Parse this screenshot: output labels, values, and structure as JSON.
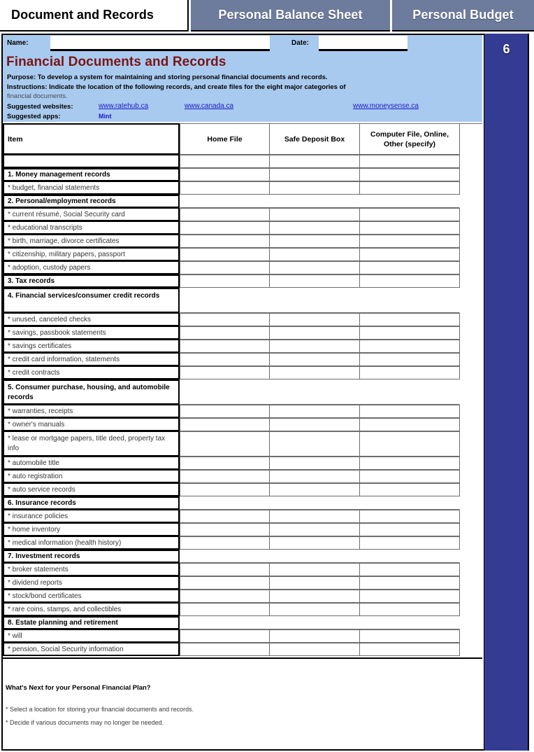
{
  "tabs": [
    {
      "label": "Document and Records",
      "active": true
    },
    {
      "label": "Personal Balance Sheet",
      "active": false
    },
    {
      "label": "Personal Budget",
      "active": false
    }
  ],
  "sidebar": {
    "page_number": "6"
  },
  "header": {
    "name_label": "Name:",
    "name_value": "",
    "name_placeholder": "",
    "date_label": "Date:",
    "date_value": "",
    "date_placeholder": "",
    "title": "Financial Documents and Records",
    "purpose": "Purpose: To develop a system for maintaining and storing personal financial documents and records.",
    "instructions_line1": "Instructions: Indicate the location of the following records, and create files for the eight major categories of",
    "instructions_line2": "financial documents.",
    "websites_label": "Suggested websites:",
    "apps_label": "Suggested apps:",
    "websites": [
      "www.ratehub.ca",
      "www.canada.ca",
      "www.moneysense.ca"
    ],
    "apps": [
      "Mint"
    ]
  },
  "table": {
    "columns": [
      "Item",
      "Home File",
      "Safe Deposit Box",
      "Computer File, Online, Other (specify)"
    ],
    "rows": [
      {
        "label": "",
        "type": "blank",
        "cells": [
          "",
          "",
          ""
        ]
      },
      {
        "label": "1. Money management records",
        "type": "section",
        "cells": [
          "",
          "",
          ""
        ]
      },
      {
        "label": "* budget, financial statements",
        "type": "item",
        "cells": [
          "",
          "",
          ""
        ]
      },
      {
        "label": "2. Personal/employment records",
        "type": "section",
        "cells": []
      },
      {
        "label": "* current résumé, Social Security card",
        "type": "item",
        "cells": [
          "",
          "",
          ""
        ]
      },
      {
        "label": "* educational transcripts",
        "type": "item",
        "cells": [
          "",
          "",
          ""
        ]
      },
      {
        "label": "* birth, marriage, divorce certificates",
        "type": "item",
        "cells": [
          "",
          "",
          ""
        ]
      },
      {
        "label": "* citizenship, military papers, passport",
        "type": "item",
        "cells": [
          "",
          "",
          ""
        ]
      },
      {
        "label": "* adoption, custody papers",
        "type": "item",
        "cells": [
          "",
          "",
          ""
        ]
      },
      {
        "label": "3. Tax records",
        "type": "section",
        "cells": [
          "",
          "",
          ""
        ]
      },
      {
        "label": "4. Financial services/consumer credit records",
        "type": "section2",
        "cells": []
      },
      {
        "label": "* unused, canceled checks",
        "type": "item",
        "cells": [
          "",
          "",
          ""
        ]
      },
      {
        "label": "* savings, passbook statements",
        "type": "item",
        "cells": [
          "",
          "",
          ""
        ]
      },
      {
        "label": "* savings certificates",
        "type": "item",
        "cells": [
          "",
          "",
          ""
        ]
      },
      {
        "label": "* credit card information, statements",
        "type": "item",
        "cells": [
          "",
          "",
          ""
        ]
      },
      {
        "label": "* credit contracts",
        "type": "item",
        "cells": [
          "",
          "",
          ""
        ]
      },
      {
        "label": "5. Consumer purchase, housing, and automobile records",
        "type": "section2",
        "cells": []
      },
      {
        "label": "* warranties, receipts",
        "type": "item",
        "cells": [
          "",
          "",
          ""
        ]
      },
      {
        "label": "* owner's manuals",
        "type": "item",
        "cells": [
          "",
          "",
          ""
        ]
      },
      {
        "label": "* lease or mortgage papers, title deed, property tax info",
        "type": "item2",
        "cells": [
          "",
          "",
          ""
        ]
      },
      {
        "label": "* automobile title",
        "type": "item",
        "cells": [
          "",
          "",
          ""
        ]
      },
      {
        "label": "* auto registration",
        "type": "item",
        "cells": [
          "",
          "",
          ""
        ]
      },
      {
        "label": "* auto service records",
        "type": "item",
        "cells": [
          "",
          "",
          ""
        ]
      },
      {
        "label": "6. Insurance records",
        "type": "section",
        "cells": []
      },
      {
        "label": "* insurance policies",
        "type": "item",
        "cells": [
          "",
          "",
          ""
        ]
      },
      {
        "label": "* home inventory",
        "type": "item",
        "cells": [
          "",
          "",
          ""
        ]
      },
      {
        "label": "* medical information (health history)",
        "type": "item",
        "cells": [
          "",
          "",
          ""
        ]
      },
      {
        "label": "7. Investment records",
        "type": "section",
        "cells": []
      },
      {
        "label": "* broker statements",
        "type": "item",
        "cells": [
          "",
          "",
          ""
        ]
      },
      {
        "label": "* dividend reports",
        "type": "item",
        "cells": [
          "",
          "",
          ""
        ]
      },
      {
        "label": "* stock/bond certificates",
        "type": "item",
        "cells": [
          "",
          "",
          ""
        ]
      },
      {
        "label": "* rare coins, stamps, and collectibles",
        "type": "item",
        "cells": [
          "",
          "",
          ""
        ]
      },
      {
        "label": "8. Estate planning and retirement",
        "type": "section",
        "cells": []
      },
      {
        "label": "* will",
        "type": "item",
        "cells": [
          "",
          "",
          ""
        ]
      },
      {
        "label": "* pension, Social Security information",
        "type": "item",
        "cells": [
          "",
          "",
          ""
        ]
      }
    ]
  },
  "footer": {
    "heading": "What's Next for your Personal Financial Plan?",
    "bullets": [
      "* Select a location for storing your financial documents and records.",
      "* Decide if various documents may no longer be needed."
    ]
  }
}
